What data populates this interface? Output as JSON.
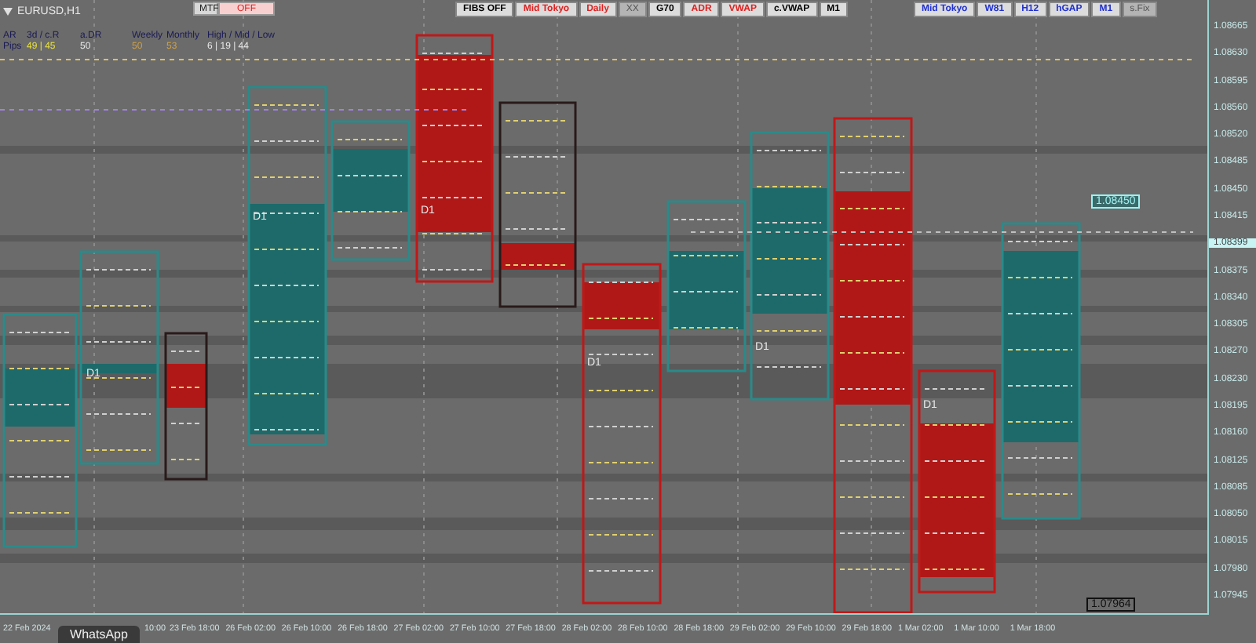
{
  "window": {
    "title": "EURUSD,H1"
  },
  "mtf": [
    {
      "label": "MTF",
      "kind": "plain"
    },
    {
      "label": "OFF",
      "kind": "alert"
    }
  ],
  "stats": {
    "rows": [
      {
        "cells": [
          {
            "text": "AR",
            "color": "#1a1a55"
          },
          {
            "text": "3d / c.R",
            "color": "#1a1a55"
          },
          {
            "text": "a.DR",
            "color": "#1a1a55"
          },
          {
            "text": "Weekly",
            "color": "#1a1a55"
          },
          {
            "text": "Monthly",
            "color": "#1a1a55"
          },
          {
            "text": "High / Mid / Low",
            "color": "#1a1a55"
          }
        ]
      },
      {
        "cells": [
          {
            "text": "Pips",
            "color": "#1a1a55"
          },
          {
            "text": "49 | 45",
            "color": "#e8e040"
          },
          {
            "text": "50",
            "color": "#e8e8e8"
          },
          {
            "text": "50",
            "color": "#d0a040"
          },
          {
            "text": "53",
            "color": "#d0a040"
          },
          {
            "text": "6 | 19 | 44",
            "color": "#e8e8e8"
          }
        ]
      }
    ]
  },
  "toolbar_center": [
    {
      "label": "FIBS OFF",
      "color": "#000000",
      "disabled": false
    },
    {
      "label": "Mid Tokyo",
      "color": "#e02020",
      "disabled": false
    },
    {
      "label": "Daily",
      "color": "#e02020",
      "disabled": false
    },
    {
      "label": "XX",
      "color": "#555555",
      "disabled": true
    },
    {
      "label": "G70",
      "color": "#000000",
      "disabled": false
    },
    {
      "label": "ADR",
      "color": "#e02020",
      "disabled": false
    },
    {
      "label": "VWAP",
      "color": "#e02020",
      "disabled": false
    },
    {
      "label": "c.VWAP",
      "color": "#000000",
      "disabled": false
    },
    {
      "label": "M1",
      "color": "#000000",
      "disabled": false
    }
  ],
  "toolbar_right": [
    {
      "label": "Mid Tokyo",
      "color": "#2030d0",
      "disabled": false
    },
    {
      "label": "W81",
      "color": "#2030d0",
      "disabled": false
    },
    {
      "label": "H12",
      "color": "#2030d0",
      "disabled": false
    },
    {
      "label": "hGAP",
      "color": "#2030d0",
      "disabled": false
    },
    {
      "label": "M1",
      "color": "#2030d0",
      "disabled": false
    },
    {
      "label": "s.Fix",
      "color": "#555555",
      "disabled": true
    }
  ],
  "chart": {
    "period_labels": [
      "D1",
      "D1",
      "D1",
      "D1",
      "D1",
      "D1"
    ],
    "price_tags": [
      "1.08450",
      "1.07964"
    ]
  },
  "price_axis": {
    "ticks": [
      {
        "label": "1.08665",
        "current": false
      },
      {
        "label": "1.08630",
        "current": false
      },
      {
        "label": "1.08595",
        "current": false
      },
      {
        "label": "1.08560",
        "current": false
      },
      {
        "label": "1.08520",
        "current": false
      },
      {
        "label": "1.08485",
        "current": false
      },
      {
        "label": "1.08450",
        "current": false
      },
      {
        "label": "1.08415",
        "current": false
      },
      {
        "label": "1.08399",
        "current": true
      },
      {
        "label": "1.08375",
        "current": false
      },
      {
        "label": "1.08340",
        "current": false
      },
      {
        "label": "1.08305",
        "current": false
      },
      {
        "label": "1.08270",
        "current": false
      },
      {
        "label": "1.08230",
        "current": false
      },
      {
        "label": "1.08195",
        "current": false
      },
      {
        "label": "1.08160",
        "current": false
      },
      {
        "label": "1.08125",
        "current": false
      },
      {
        "label": "1.08085",
        "current": false
      },
      {
        "label": "1.08050",
        "current": false
      },
      {
        "label": "1.08015",
        "current": false
      },
      {
        "label": "1.07980",
        "current": false
      },
      {
        "label": "1.07945",
        "current": false
      }
    ]
  },
  "time_axis": [
    "22 Feb 2024",
    "10:00",
    "23 Feb 18:00",
    "26 Feb 02:00",
    "26 Feb 10:00",
    "26 Feb 18:00",
    "27 Feb 02:00",
    "27 Feb 10:00",
    "27 Feb 18:00",
    "28 Feb 02:00",
    "28 Feb 10:00",
    "28 Feb 18:00",
    "29 Feb 02:00",
    "29 Feb 10:00",
    "29 Feb 18:00",
    "1 Mar 02:00",
    "1 Mar 10:00",
    "1 Mar 18:00"
  ],
  "taskbar_tab": {
    "label": "WhatsApp"
  }
}
